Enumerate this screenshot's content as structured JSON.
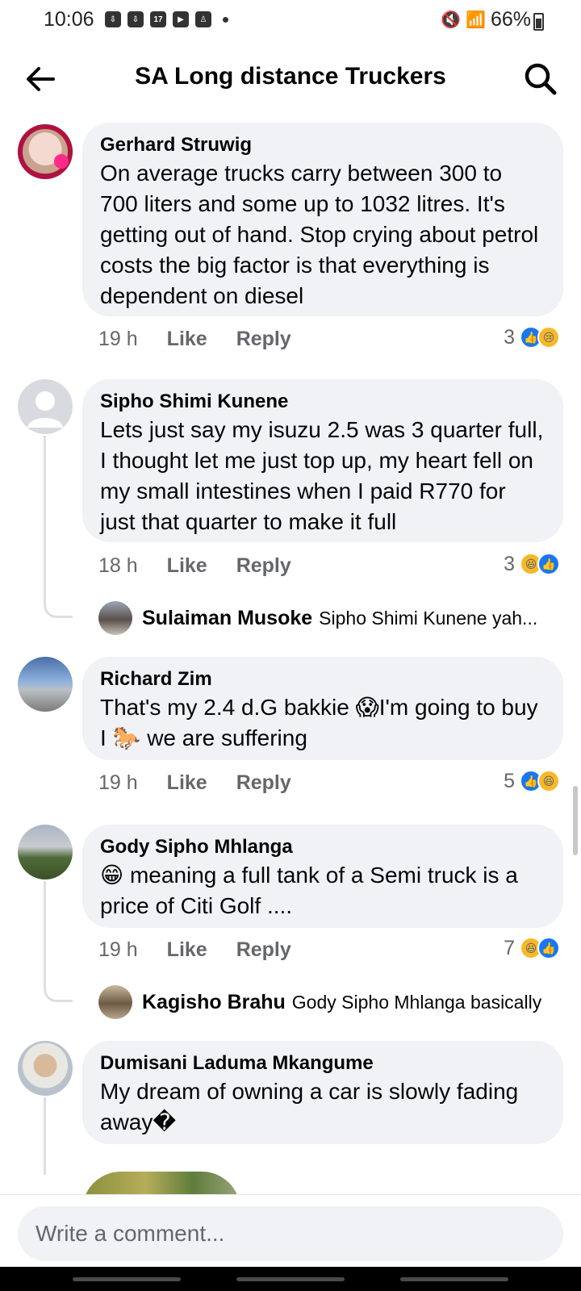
{
  "status": {
    "time": "10:06",
    "battery": "66%"
  },
  "header": {
    "title": "SA Long distance Truckers"
  },
  "comments": [
    {
      "author": "Gerhard Struwig",
      "text": "On average trucks carry between 300 to 700 liters and some up to 1032 litres. It's getting out of hand. Stop crying about petrol costs the big factor is that everything is dependent on diesel",
      "time": "19 h",
      "like": "Like",
      "reply": "Reply",
      "reaction_count": "3",
      "reactions": [
        "like-icon",
        "sad-icon"
      ]
    },
    {
      "author": "Sipho Shimi Kunene",
      "text": "Lets just say my isuzu 2.5 was 3 quarter full, I thought let me just top up, my heart fell on my small intestines when I paid R770 for just that quarter to make it full",
      "time": "18 h",
      "like": "Like",
      "reply": "Reply",
      "reaction_count": "3",
      "reactions": [
        "haha-icon",
        "like-icon"
      ],
      "reply_preview": {
        "author": "Sulaiman Musoke",
        "text": "Sipho Shimi Kunene yah..."
      }
    },
    {
      "author": "Richard Zim",
      "text": "That's my 2.4 d.G bakkie 😱I'm going to buy I 🐎 we are suffering",
      "time": "19 h",
      "like": "Like",
      "reply": "Reply",
      "reaction_count": "5",
      "reactions": [
        "like-icon",
        "haha-icon"
      ]
    },
    {
      "author": "Gody Sipho Mhlanga",
      "text": "😁 meaning a full tank of a Semi truck is a price of Citi Golf ....",
      "time": "19 h",
      "like": "Like",
      "reply": "Reply",
      "reaction_count": "7",
      "reactions": [
        "haha-icon",
        "like-icon"
      ],
      "reply_preview": {
        "author": "Kagisho Brahu",
        "text": "Gody Sipho Mhlanga basically"
      }
    },
    {
      "author": "Dumisani Laduma Mkangume",
      "text": "My dream of owning a car is slowly fading away�"
    }
  ],
  "composer": {
    "placeholder": "Write a comment..."
  }
}
